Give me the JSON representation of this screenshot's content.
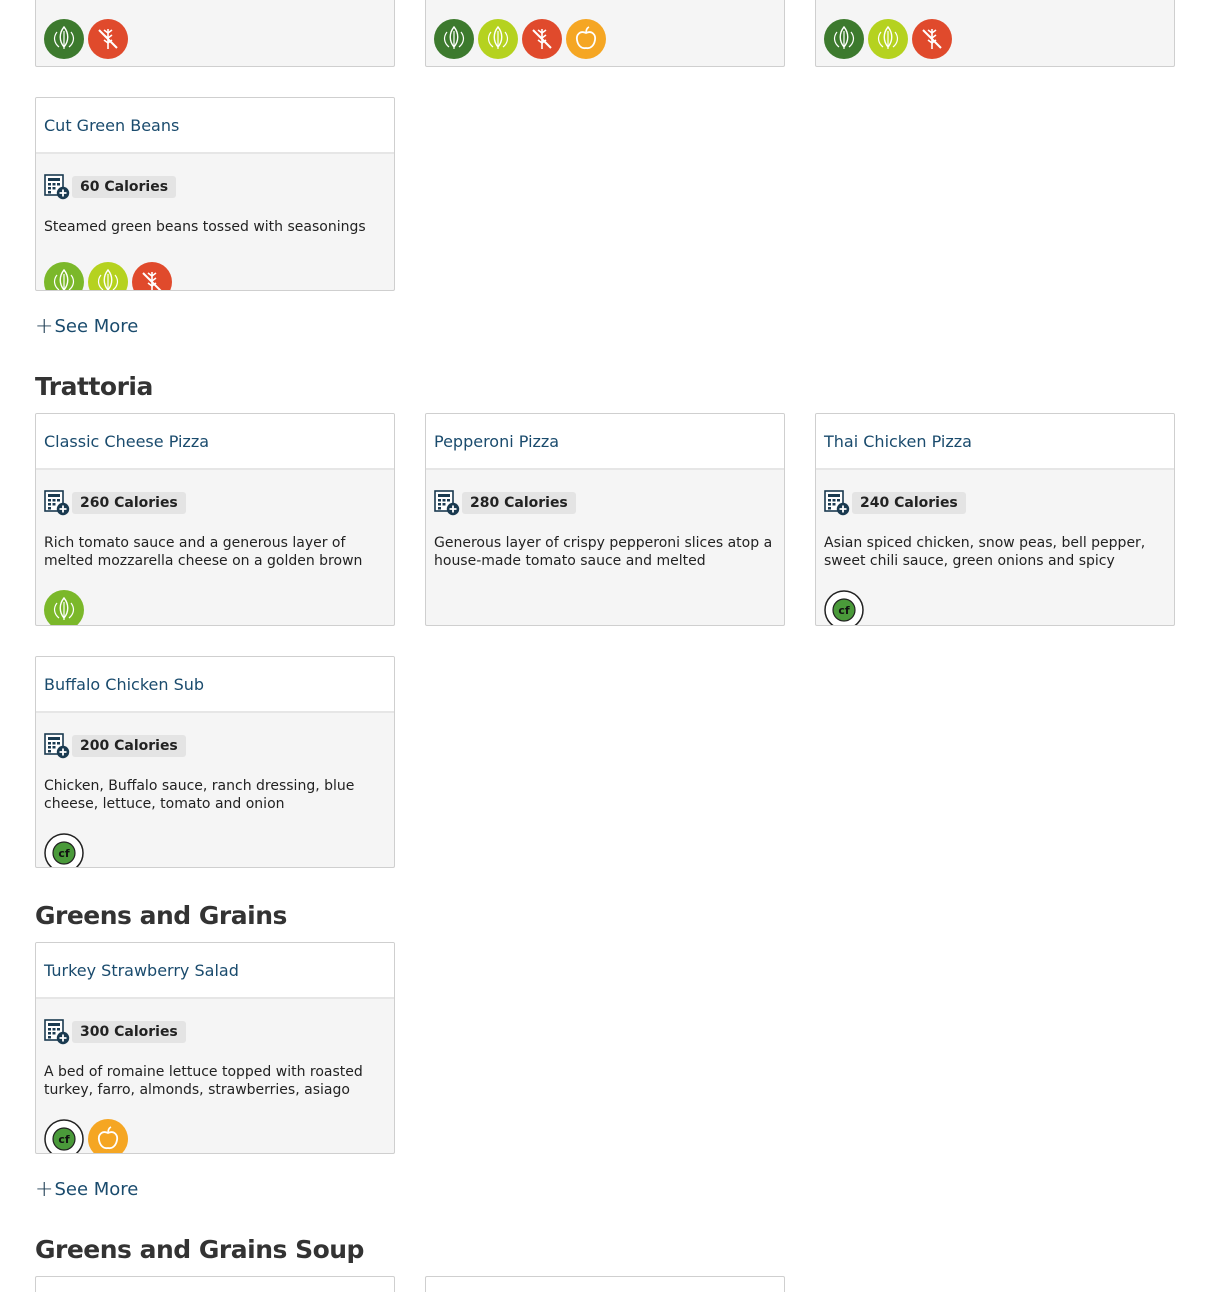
{
  "top_cards": [
    {
      "badges": [
        "vegan",
        "gluten-free"
      ]
    },
    {
      "badges": [
        "vegan",
        "plant-forward",
        "gluten-free",
        "eat-well"
      ]
    },
    {
      "badges": [
        "vegan",
        "plant-forward",
        "gluten-free"
      ]
    }
  ],
  "sections": {
    "sides": {
      "items": [
        {
          "name": "Cut Green Beans",
          "calories": "60 Calories",
          "description": "Steamed green beans tossed with seasonings",
          "badges": [
            "vegetarian",
            "plant-forward",
            "gluten-free"
          ]
        }
      ],
      "see_more": "See More"
    },
    "trattoria": {
      "title": "Trattoria",
      "items": [
        {
          "name": "Classic Cheese Pizza",
          "calories": "260 Calories",
          "description": "Rich tomato sauce and a generous layer of melted mozzarella cheese on a golden brown crust",
          "badges": [
            "vegetarian"
          ]
        },
        {
          "name": "Pepperoni Pizza",
          "calories": "280 Calories",
          "description": "Generous layer of crispy pepperoni slices atop a house-made tomato sauce and melted mozzarella",
          "badges": []
        },
        {
          "name": "Thai Chicken Pizza",
          "calories": "240 Calories",
          "description": "Asian spiced chicken, snow peas, bell pepper, sweet chili sauce, green onions and spicy peanut sauce",
          "badges": [
            "low-carbon"
          ]
        },
        {
          "name": "Buffalo Chicken Sub",
          "calories": "200 Calories",
          "description": "Chicken, Buffalo sauce, ranch dressing, blue cheese, lettuce, tomato and onion",
          "badges": [
            "low-carbon"
          ]
        }
      ]
    },
    "greens": {
      "title": "Greens and Grains",
      "items": [
        {
          "name": "Turkey Strawberry Salad",
          "calories": "300 Calories",
          "description": "A bed of romaine lettuce topped with roasted turkey, farro, almonds, strawberries, asiago chees...",
          "badges": [
            "low-carbon",
            "eat-well"
          ]
        }
      ],
      "see_more": "See More"
    },
    "soup": {
      "title": "Greens and Grains Soup"
    }
  },
  "badge_labels": {
    "vegan": "VEGAN",
    "vegetarian": "VEGETARIAN",
    "plant-forward": "PLANT FORWARD",
    "gluten-free": "GLUTEN",
    "eat-well": "EAT WELL",
    "low-carbon": "LOW CARBON"
  },
  "colors": {
    "vegan": "#3d7a2e",
    "vegetarian": "#7bb82a",
    "plant-forward": "#b5d21f",
    "gluten-free": "#e04a2c",
    "eat-well": "#f5a623",
    "link": "#1a4b6d"
  }
}
